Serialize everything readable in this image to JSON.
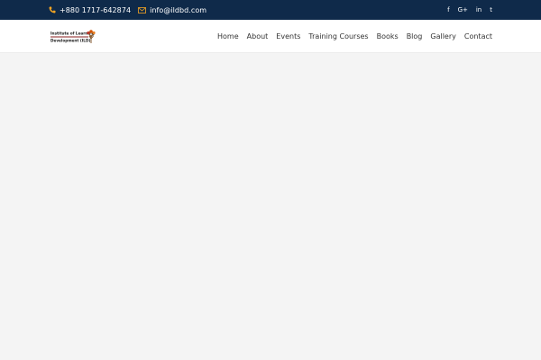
{
  "topbar": {
    "phone": {
      "icon": "phone-icon",
      "text": "+880 1717-642874"
    },
    "email": {
      "icon": "envelope-icon",
      "text": "info@ildbd.com"
    },
    "social": [
      {
        "name": "facebook-icon",
        "glyph": "f"
      },
      {
        "name": "google-plus-icon",
        "glyph": "G+"
      },
      {
        "name": "linkedin-icon",
        "glyph": "in"
      },
      {
        "name": "twitter-icon",
        "glyph": "t"
      }
    ]
  },
  "header": {
    "logo": {
      "line1": "Institute of Learning",
      "line2": "Development (ILD)"
    },
    "nav": [
      {
        "label": "Home"
      },
      {
        "label": "About"
      },
      {
        "label": "Events"
      },
      {
        "label": "Training Courses"
      },
      {
        "label": "Books"
      },
      {
        "label": "Blog"
      },
      {
        "label": "Gallery"
      },
      {
        "label": "Contact"
      }
    ]
  },
  "colors": {
    "topbar_bg": "#0f2a4a",
    "icon_accent": "#f5a623",
    "page_bg": "#f4f4f4",
    "nav_text": "#333333"
  }
}
